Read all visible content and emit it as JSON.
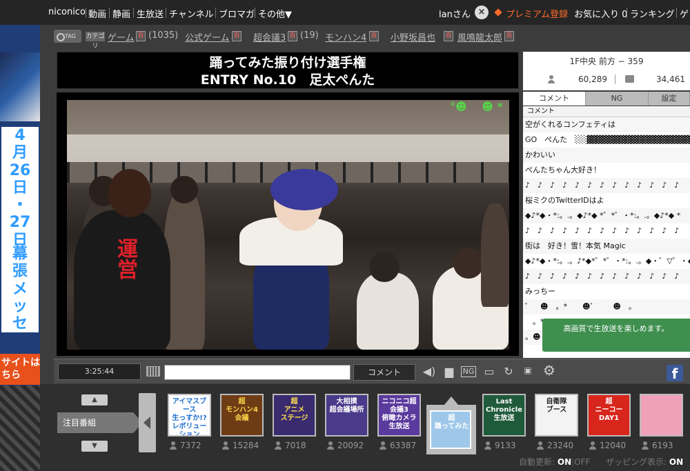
{
  "topnav": {
    "links": [
      "niconico",
      "動画",
      "静画",
      "生放送",
      "チャンネル",
      "ブロマガ",
      "その他▼"
    ],
    "user": "lanさん",
    "close_icon": "×",
    "premium": "プレミアム登録",
    "favorites": "お気に入り 0",
    "ranking": "ランキング",
    "more": "ゲ"
  },
  "tags": {
    "tag_label": "TAG",
    "category_label": "カテゴリ",
    "dict_icon": "百",
    "items": [
      {
        "name": "ゲーム",
        "count": "(1035)"
      },
      {
        "name": "公式ゲーム",
        "count": ""
      },
      {
        "name": "超会議3",
        "count": "(19)"
      },
      {
        "name": "モンハン4",
        "count": ""
      },
      {
        "name": "小野坂昌也",
        "count": ""
      },
      {
        "name": "風鳴龍太郎",
        "count": ""
      }
    ]
  },
  "left_ad": {
    "date_lines": [
      "4",
      "月",
      "26",
      "日",
      "・",
      "27",
      "日"
    ],
    "venue": "幕張メッセ",
    "site_text": "サイトは\nちら"
  },
  "title": {
    "line1": "踊ってみた振り付け選手権",
    "line2": "ENTRY No.10　足太ぺんた"
  },
  "right_panel": {
    "seat": "1F中央 前方 − 359",
    "viewers": "60,289",
    "comment_count": "34,461",
    "tabs": [
      "コメント",
      "NG",
      "設定"
    ],
    "comment_header": "コメント",
    "comments": [
      "空がくれるコンフェティは",
      "GO　ぺんた　░░▓▓▓▓▓▓▓▓▓▓▓▓▓▓▓▓▓▓▓▓▓",
      "かわいい",
      "ぺんたちゃん大好き！",
      "♪　♪　♪　♪　♪　♪　♪　♪　♪　♪　♪　♪　♪",
      "桜ミクのTwitterIDはよ",
      "◆♪*◆・*:。.。◆♪*◆ *゜*゜・*:。.。◆♪*◆ *",
      "♪　♪　♪　♪　♪　♪　♪　♪　♪　♪　♪　♪　♪",
      "街は　好き！雪！本気 Magic",
      "◆♪*◆・*:。.。♪*◆*゜*゜・*:。.。◆・゜▽゜・◆ ♪",
      "♪　♪　♪　♪　♪　♪　♪　♪　♪　♪　♪　♪　♪",
      "みっちー",
      "゜　☻　。*　　☻゜　　☻　。",
      "　。*",
      "。☻"
    ],
    "notice": "高画質で生放送を楽しめます。"
  },
  "controls": {
    "time": "3:25:44",
    "comment_placeholder": "",
    "comment_button": "コメント",
    "fb": "f"
  },
  "bottom": {
    "featured_label": "注目番組",
    "programs": [
      {
        "title": "アイマスブース\n生っすか!?\nレボリューション\nステージ",
        "count": "7372",
        "bg": "#ffffff",
        "fg": "#1d6fd1"
      },
      {
        "title": "超\nモンハン4\n会議",
        "count": "15284",
        "bg": "#6e3c14",
        "fg": "#ffd54a"
      },
      {
        "title": "超\nアニメ\nステージ",
        "count": "7018",
        "bg": "#3a2a6e",
        "fg": "#ffe34f"
      },
      {
        "title": "大相撲\n超会議場所",
        "count": "20092",
        "bg": "#4a3a8a",
        "fg": "#ffffff"
      },
      {
        "title": "ニコニコ超会議3\n俯瞰カメラ\n生放送",
        "count": "63387",
        "bg": "#5b3a9e",
        "fg": "#ffffff"
      },
      {
        "title": "超\n踊ってみた",
        "count": "",
        "bg": "#9ec7ea",
        "fg": "#ffffff"
      },
      {
        "title": "Last\nChronicle\n生放送",
        "count": "9133",
        "bg": "#1f5a3a",
        "fg": "#ffffff"
      },
      {
        "title": "自衛隊\nブース",
        "count": "23240",
        "bg": "#f3f3f3",
        "fg": "#1f1f1f"
      },
      {
        "title": "超\nニーコー\nDAY1",
        "count": "12040",
        "bg": "#d8261d",
        "fg": "#ffffff"
      },
      {
        "title": "",
        "count": "6193",
        "bg": "#f0a0b8",
        "fg": "#ffffff"
      }
    ],
    "auto_update_label": "自動更新:",
    "auto_update_on": "ON",
    "auto_update_off": "OFF",
    "zapping_label": "ザッピング表示:",
    "zapping_on": "ON"
  },
  "colors": {
    "premium": "#ff6a2a",
    "notice_bg": "#3f8f4f",
    "facebook": "#3b5998"
  }
}
